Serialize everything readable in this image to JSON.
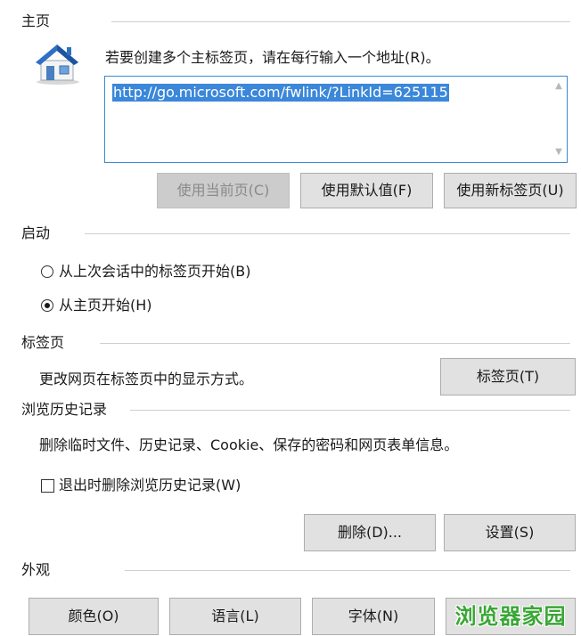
{
  "home": {
    "section_title": "主页",
    "icon": "home-icon",
    "instruction": "若要创建多个主标签页，请在每行输入一个地址(R)。",
    "url_value": "http://go.microsoft.com/fwlink/?LinkId=625115",
    "buttons": {
      "use_current": "使用当前页(C)",
      "use_default": "使用默认值(F)",
      "use_new_tab": "使用新标签页(U)"
    }
  },
  "startup": {
    "section_title": "启动",
    "options": [
      {
        "label": "从上次会话中的标签页开始(B)",
        "checked": false
      },
      {
        "label": "从主页开始(H)",
        "checked": true
      }
    ]
  },
  "tabs": {
    "section_title": "标签页",
    "description": "更改网页在标签页中的显示方式。",
    "button": "标签页(T)"
  },
  "history": {
    "section_title": "浏览历史记录",
    "description": "删除临时文件、历史记录、Cookie、保存的密码和网页表单信息。",
    "checkbox_label": "退出时删除浏览历史记录(W)",
    "checkbox_checked": false,
    "buttons": {
      "delete": "删除(D)...",
      "settings": "设置(S)"
    }
  },
  "appearance": {
    "section_title": "外观",
    "buttons": {
      "colors": "颜色(O)",
      "languages": "语言(L)",
      "fonts": "字体(N)"
    }
  },
  "watermark": "浏览器家园",
  "colors": {
    "accent": "#3b87d9",
    "button_bg": "#e1e1e1",
    "disabled_bg": "#cccccc",
    "watermark": "#3aa635"
  }
}
